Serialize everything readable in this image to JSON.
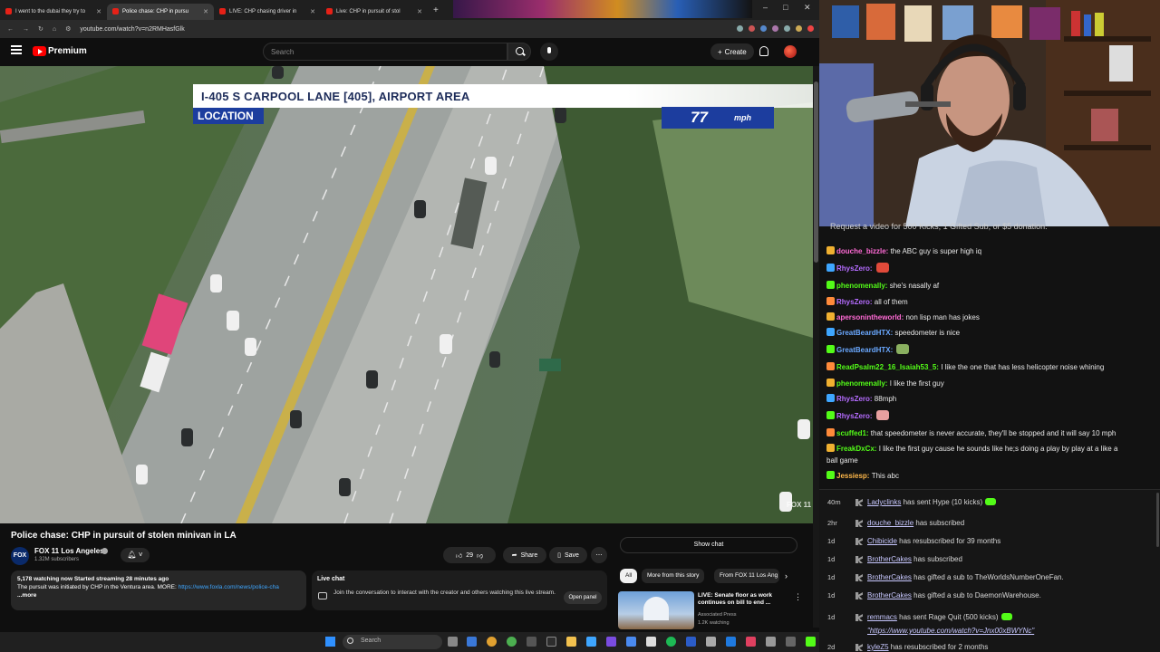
{
  "browser": {
    "tabs": [
      {
        "title": "I went to the dubai they try to"
      },
      {
        "title": "Police chase: CHP in pursu"
      },
      {
        "title": "LIVE: CHP chasing driver in"
      },
      {
        "title": "Live: CHP in pursuit of stol"
      }
    ],
    "url": "youtube.com/watch?v=n2RMHasfGlk"
  },
  "youtube": {
    "brand": "Premium",
    "search_placeholder": "Search",
    "create_label": "Create"
  },
  "video": {
    "banner_title": "I-405 S CARPOOL LANE [405], AIRPORT AREA",
    "banner_tag": "LOCATION",
    "speed_value": "77",
    "speed_unit": "mph",
    "watermark": "FOX 11",
    "title": "Police chase: CHP in pursuit of stolen minivan in LA",
    "channel_avatar_text": "FOX 11",
    "channel_name": "FOX 11 Los Angeles",
    "subscribers": "1.32M subscribers",
    "likes": "29",
    "share_label": "Share",
    "save_label": "Save",
    "show_chat_label": "Show chat",
    "desc_stats": "5,178 watching now  Started streaming 28 minutes ago",
    "desc_text": "The pursuit was initiated by CHP in the Ventura area. MORE: ",
    "desc_link": "https://www.foxla.com/news/police-cha",
    "desc_more": "...more",
    "livechat_title": "Live chat",
    "livechat_desc": "Join the conversation to interact with the creator and others watching this live stream.",
    "open_panel_label": "Open panel"
  },
  "recommendations": {
    "chips": [
      "All",
      "More from this story",
      "From FOX 11 Los Ang"
    ],
    "items": [
      {
        "title": "LIVE: Senate floor as work continues on bill to end ...",
        "source": "Associated Press",
        "watching": "1.2K watching"
      }
    ]
  },
  "taskbar": {
    "search_placeholder": "Search"
  },
  "chat": {
    "header": "Request a video for 500 Kicks, 1 Gifted Sub, or $5 donation.",
    "messages": [
      {
        "user": "douche_bizzle",
        "text": "the ABC guy is super high iq",
        "color": "#ff6ad5"
      },
      {
        "user": "RhysZero",
        "text": "",
        "color": "#b56cff"
      },
      {
        "user": "phenomenally",
        "text": "she's nasally af",
        "color": "#53fc18"
      },
      {
        "user": "RhysZero",
        "text": "all of them",
        "color": "#b56cff"
      },
      {
        "user": "apersonintheworld",
        "text": "non lisp man has jokes",
        "color": "#ff6ad5"
      },
      {
        "user": "GreatBeardHTX",
        "text": "speedometer is nice",
        "color": "#6aa8ff"
      },
      {
        "user": "GreatBeardHTX",
        "text": "",
        "color": "#6aa8ff"
      },
      {
        "user": "ReadPsalm22_16_Isaiah53_5",
        "text": "I like the one that has less helicopter noise whining",
        "color": "#53fc18"
      },
      {
        "user": "phenomenally",
        "text": "I like the first guy",
        "color": "#53fc18"
      },
      {
        "user": "RhysZero",
        "text": "88mph",
        "color": "#b56cff"
      },
      {
        "user": "RhysZero",
        "text": "",
        "color": "#b56cff"
      },
      {
        "user": "scuffed1",
        "text": "that speedometer is never accurate, they'll be stopped and it will say 10 mph",
        "color": "#53fc18"
      },
      {
        "user": "FreakDxCx",
        "text": "I like the first guy cause he sounds like he;s doing a play by play at a like a",
        "color": "#53fc18"
      },
      {
        "user": "",
        "text": "ball game",
        "color": "#53fc18"
      },
      {
        "user": "Jessiesp",
        "text": "This abc",
        "color": "#ffb84a"
      }
    ]
  },
  "events": [
    {
      "time": "40m",
      "user": "Ladyclinks",
      "text": " has sent Hype (10 kicks)",
      "badge": true
    },
    {
      "time": "2hr",
      "user": "douche_bizzle",
      "text": " has subscribed",
      "badge": false
    },
    {
      "time": "1d",
      "user": "Chibicide",
      "text": " has resubscribed for 39 months",
      "badge": false
    },
    {
      "time": "1d",
      "user": "BrotherCakes",
      "text": " has subscribed",
      "badge": false
    },
    {
      "time": "1d",
      "user": "BrotherCakes",
      "text": " has gifted a sub to TheWorldsNumberOneFan.",
      "badge": false
    },
    {
      "time": "1d",
      "user": "BrotherCakes",
      "text": " has gifted a sub to DaemonWarehouse.",
      "badge": false
    },
    {
      "time": "1d",
      "user": "remmacs",
      "text": " has sent Rage Quit (500 kicks)",
      "badge": true
    },
    {
      "time": "",
      "user": "",
      "text": "\"https://www.youtube.com/watch?v=Jnx00xBWYNc\"",
      "badge": false
    },
    {
      "time": "2d",
      "user": "kyleZ5",
      "text": " has resubscribed for 2 months",
      "badge": false
    }
  ]
}
